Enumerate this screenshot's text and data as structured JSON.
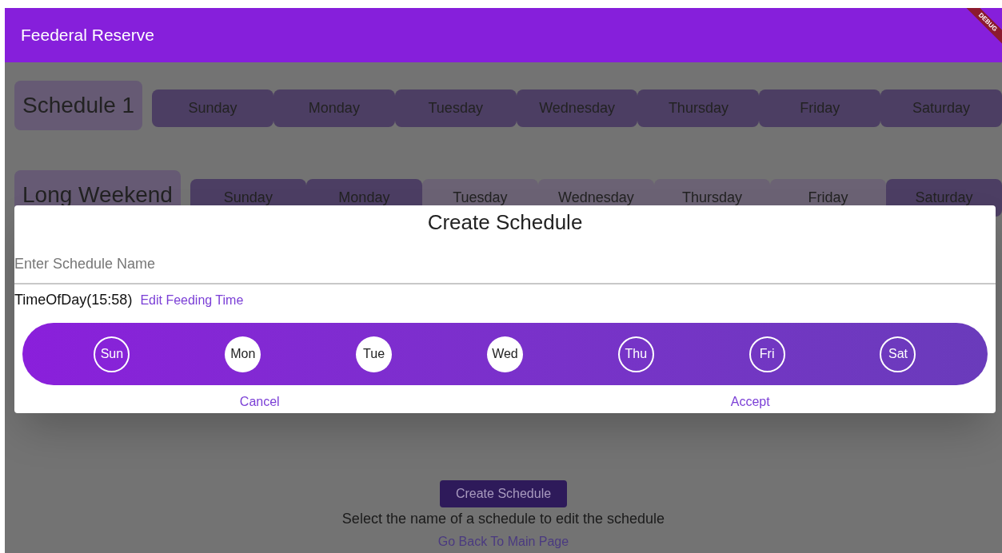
{
  "app_bar": {
    "title": "Feederal Reserve",
    "debug_banner": "DEBUG"
  },
  "schedules": [
    {
      "name": "Schedule 1",
      "days": [
        {
          "label": "Sunday",
          "selected": true
        },
        {
          "label": "Monday",
          "selected": true
        },
        {
          "label": "Tuesday",
          "selected": true
        },
        {
          "label": "Wednesday",
          "selected": true
        },
        {
          "label": "Thursday",
          "selected": true
        },
        {
          "label": "Friday",
          "selected": true
        },
        {
          "label": "Saturday",
          "selected": true
        }
      ]
    },
    {
      "name": "Long Weekend",
      "days": [
        {
          "label": "Sunday",
          "selected": true
        },
        {
          "label": "Monday",
          "selected": true
        },
        {
          "label": "Tuesday",
          "selected": false
        },
        {
          "label": "Wednesday",
          "selected": false
        },
        {
          "label": "Thursday",
          "selected": false
        },
        {
          "label": "Friday",
          "selected": false
        },
        {
          "label": "Saturday",
          "selected": true
        }
      ]
    }
  ],
  "create_button": "Create Schedule",
  "hint": "Select the name of a schedule to edit the schedule",
  "back_link": "Go Back To Main Page",
  "dialog": {
    "title": "Create Schedule",
    "name_field": {
      "placeholder": "Enter Schedule Name"
    },
    "time": "TimeOfDay(15:58)",
    "edit_time_link": "Edit Feeding Time",
    "days": [
      {
        "label": "Sun",
        "selected": false
      },
      {
        "label": "Mon",
        "selected": true
      },
      {
        "label": "Tue",
        "selected": true
      },
      {
        "label": "Wed",
        "selected": true
      },
      {
        "label": "Thu",
        "selected": false
      },
      {
        "label": "Fri",
        "selected": false
      },
      {
        "label": "Sat",
        "selected": false
      }
    ],
    "buttons": [
      "Cancel",
      "Accept"
    ]
  }
}
